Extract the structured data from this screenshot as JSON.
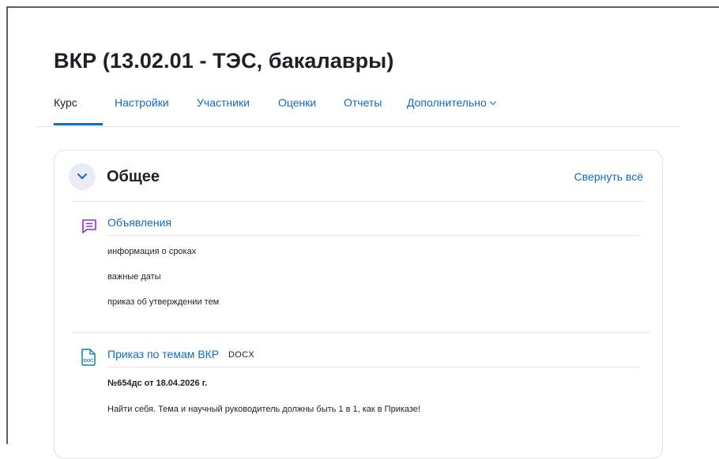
{
  "page": {
    "title": "ВКР (13.02.01 - ТЭС, бакалавры)"
  },
  "nav": {
    "items": [
      {
        "label": "Курс",
        "active": true
      },
      {
        "label": "Настройки"
      },
      {
        "label": "Участники"
      },
      {
        "label": "Оценки"
      },
      {
        "label": "Отчеты"
      },
      {
        "label": "Дополнительно"
      }
    ]
  },
  "section": {
    "title": "Общее",
    "collapse_all_label": "Свернуть всё"
  },
  "activities": [
    {
      "icon": "forum-icon",
      "link": "Объявления",
      "description": [
        "информация о сроках",
        "важные даты",
        "приказ об утверждении тем"
      ]
    },
    {
      "icon": "doc-file-icon",
      "icon_text": "DOC",
      "link": "Приказ по темам ВКР",
      "type": "DOCX",
      "description_bold": "№654дс от 18.04.2026 г.",
      "description": "Найти себя. Тема и научный руководитель должны быть 1 в 1, как в Приказе!"
    }
  ],
  "colors": {
    "link": "#0f6cbf",
    "text": "#1d2125",
    "forum_icon": "#8f2bd6",
    "doc_icon": "#0d7ec0"
  }
}
